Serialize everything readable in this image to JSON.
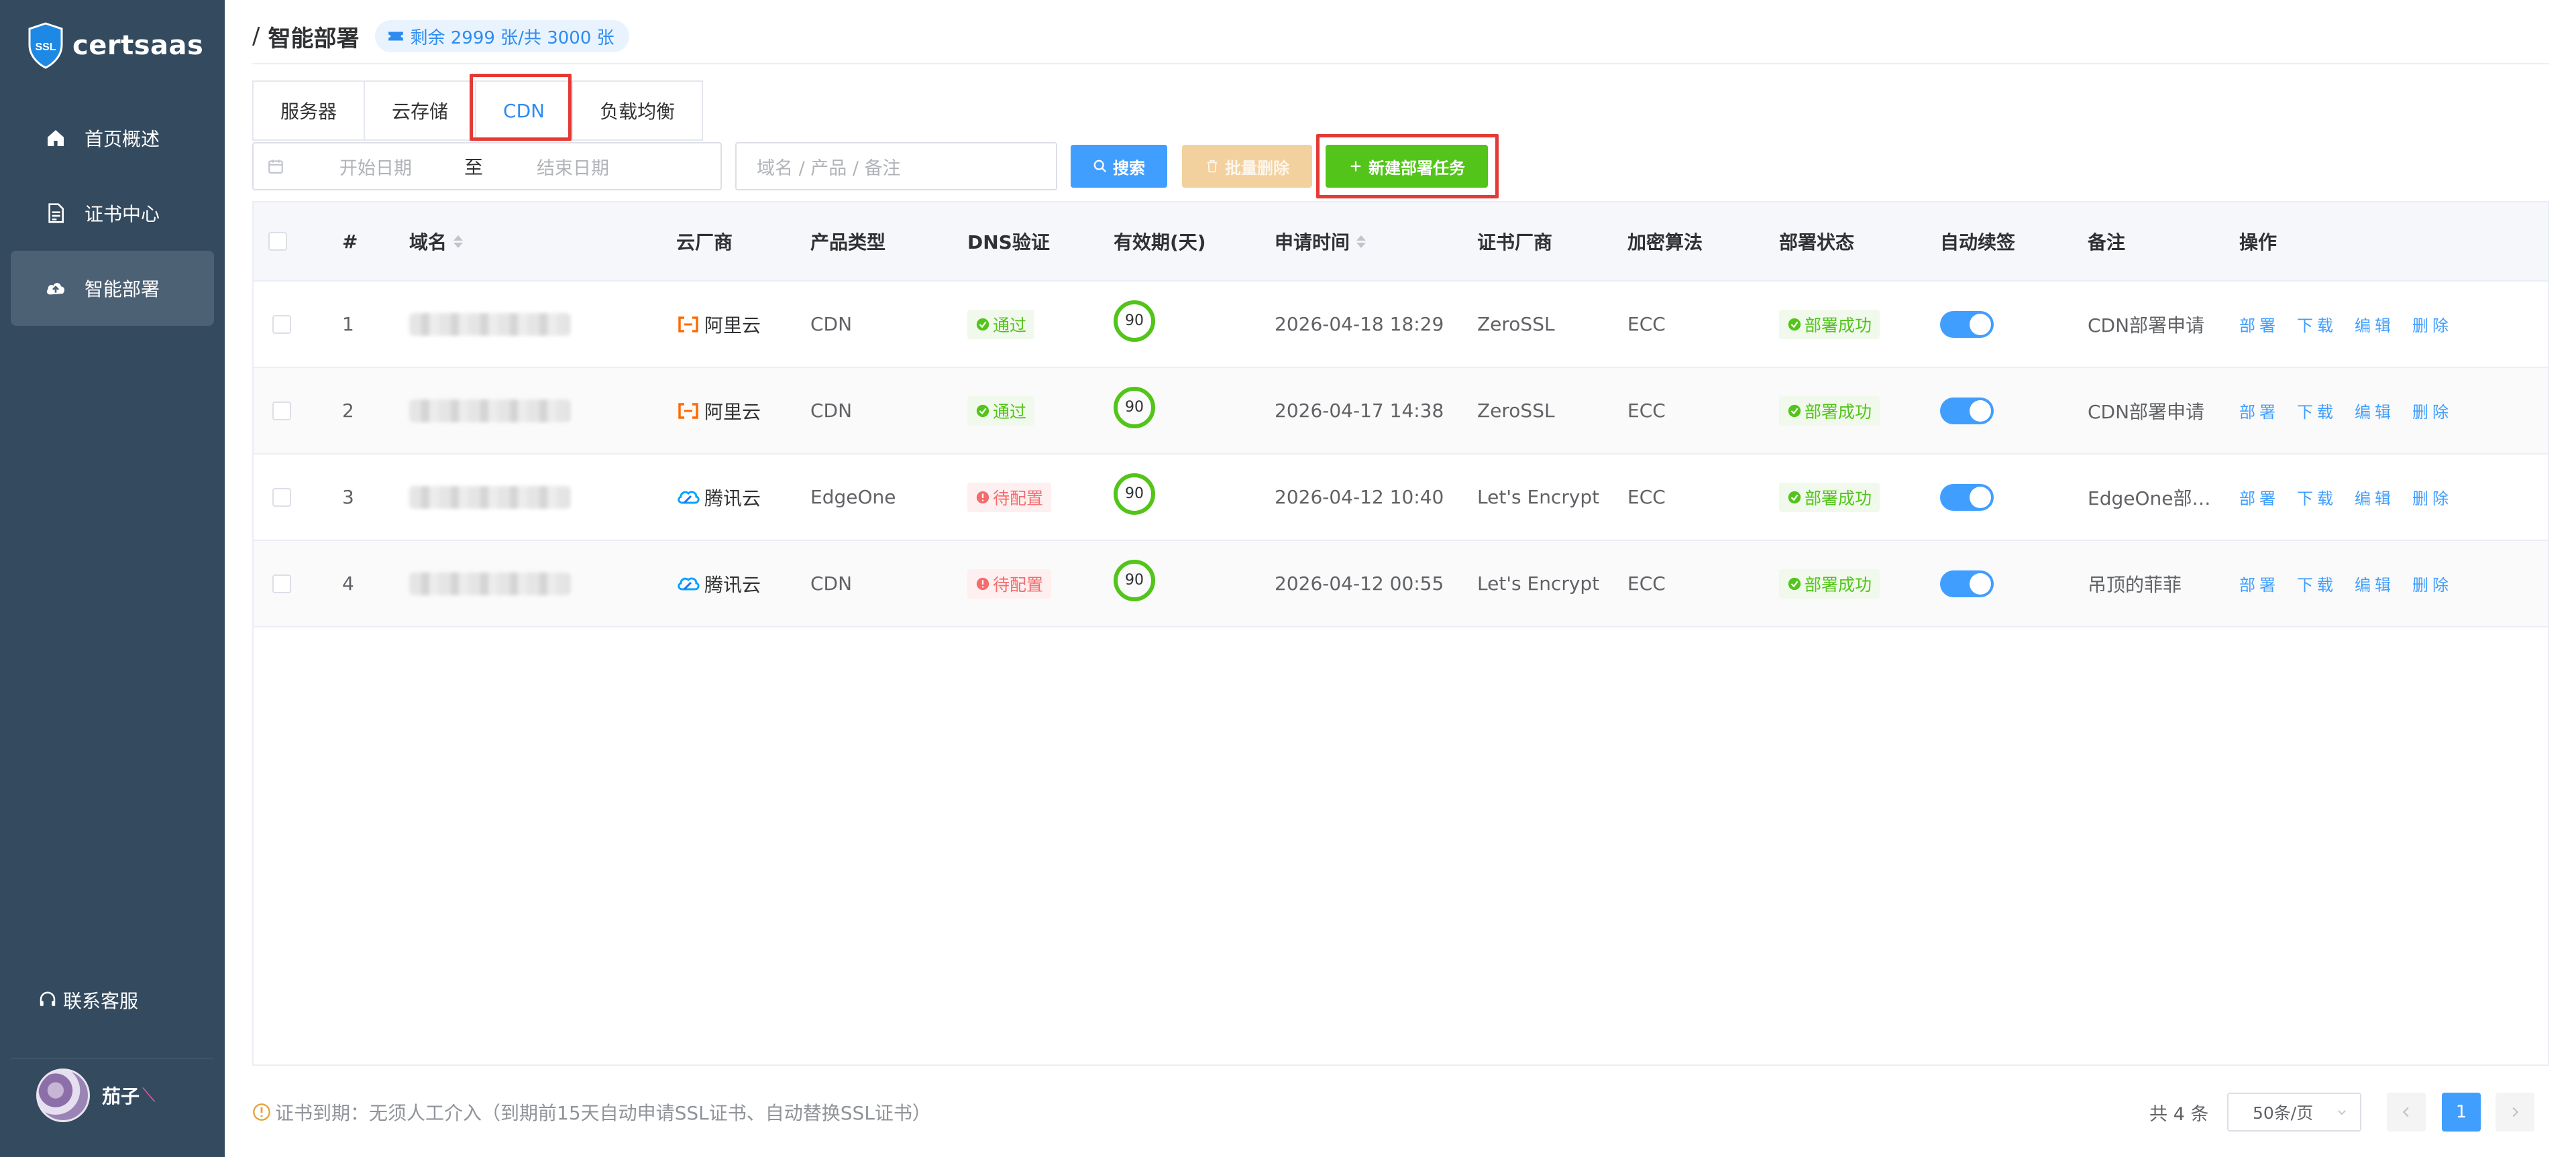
{
  "app": {
    "logo_text": "certsaas",
    "logo_badge": "SSL"
  },
  "sidebar": {
    "items": [
      {
        "label": "首页概述",
        "icon": "home-icon"
      },
      {
        "label": "证书中心",
        "icon": "document-icon"
      },
      {
        "label": "智能部署",
        "icon": "cloud-upload-icon",
        "active": true
      }
    ],
    "support_label": "联系客服",
    "user_name": "茄子"
  },
  "header": {
    "breadcrumb_sep": "/",
    "title": "智能部署",
    "quota": "剩余 2999 张/共 3000 张"
  },
  "tabs": [
    {
      "label": "服务器"
    },
    {
      "label": "云存储"
    },
    {
      "label": "CDN",
      "active": true
    },
    {
      "label": "负载均衡"
    }
  ],
  "toolbar": {
    "date_start_placeholder": "开始日期",
    "date_to": "至",
    "date_end_placeholder": "结束日期",
    "search_placeholder": "域名 / 产品 / 备注",
    "search_button": "搜索",
    "batch_delete_button": "批量删除",
    "new_task_button": "新建部署任务"
  },
  "table": {
    "columns": [
      "#",
      "域名",
      "云厂商",
      "产品类型",
      "DNS验证",
      "有效期(天)",
      "申请时间",
      "证书厂商",
      "加密算法",
      "部署状态",
      "自动续签",
      "备注",
      "操作"
    ],
    "actions": [
      "部署",
      "下载",
      "编辑",
      "删除"
    ],
    "rows": [
      {
        "index": "1",
        "vendor": "阿里云",
        "vendor_icon": "aliyun-icon",
        "product": "CDN",
        "dns": "通过",
        "dns_status": "ok",
        "days": "90",
        "applied": "2026-04-18 18:29",
        "ca": "ZeroSSL",
        "algo": "ECC",
        "deploy": "部署成功",
        "auto_renew": true,
        "note": "CDN部署申请"
      },
      {
        "index": "2",
        "vendor": "阿里云",
        "vendor_icon": "aliyun-icon",
        "product": "CDN",
        "dns": "通过",
        "dns_status": "ok",
        "days": "90",
        "applied": "2026-04-17 14:38",
        "ca": "ZeroSSL",
        "algo": "ECC",
        "deploy": "部署成功",
        "auto_renew": true,
        "note": "CDN部署申请"
      },
      {
        "index": "3",
        "vendor": "腾讯云",
        "vendor_icon": "tencent-cloud-icon",
        "product": "EdgeOne",
        "dns": "待配置",
        "dns_status": "warn",
        "days": "90",
        "applied": "2026-04-12 10:40",
        "ca": "Let's Encrypt",
        "algo": "ECC",
        "deploy": "部署成功",
        "auto_renew": true,
        "note": "EdgeOne部…"
      },
      {
        "index": "4",
        "vendor": "腾讯云",
        "vendor_icon": "tencent-cloud-icon",
        "product": "CDN",
        "dns": "待配置",
        "dns_status": "warn",
        "days": "90",
        "applied": "2026-04-12 00:55",
        "ca": "Let's Encrypt",
        "algo": "ECC",
        "deploy": "部署成功",
        "auto_renew": true,
        "note": "吊顶的菲菲"
      }
    ]
  },
  "footer": {
    "note": "证书到期：无须人工介入（到期前15天自动申请SSL证书、自动替换SSL证书）",
    "total": "共 4 条",
    "page_size": "50条/页",
    "current_page": "1"
  },
  "colors": {
    "sidebar_bg": "#344a5e",
    "primary": "#409eff",
    "success": "#52c41a",
    "danger": "#f56c6c",
    "highlight_box": "#e53935"
  }
}
